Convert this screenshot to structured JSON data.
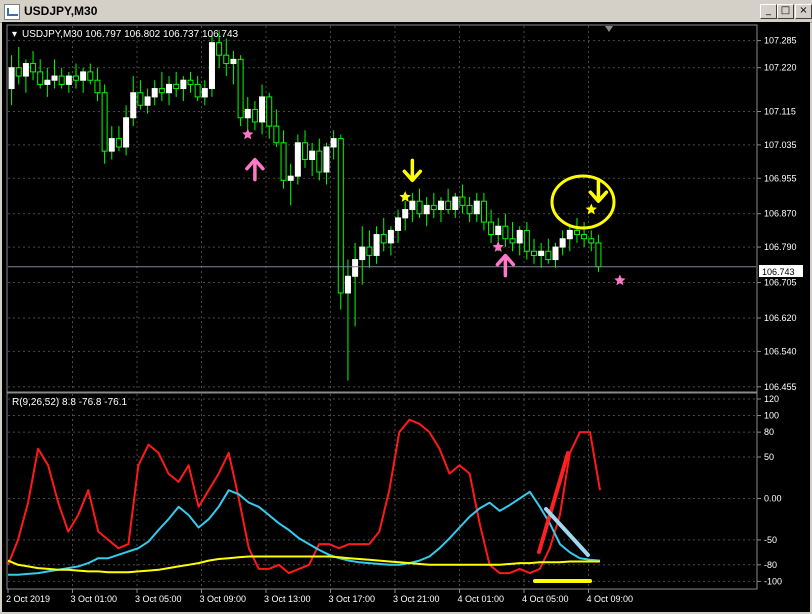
{
  "window": {
    "title": "USDJPY,M30",
    "buttons": {
      "minimize": "_",
      "maximize": "□",
      "close": "×"
    }
  },
  "colors": {
    "background": "#000000",
    "bull_candle": "#ffffff",
    "bear_candle": "#ffffff",
    "wick": "#00ff00",
    "grid": "#4a4a4a",
    "osc_red": "#ff1a1a",
    "osc_cyan": "#33ccee",
    "osc_yellow": "#ffff00",
    "arrow_pink": "#ff77c8",
    "arrow_yellow": "#ffff00",
    "annot_red": "#ff2020",
    "annot_lightblue": "#a0d8f0",
    "annot_yellow": "#ffff00",
    "price_line": "#778899"
  },
  "chart_data": [
    {
      "type": "candlestick",
      "legend": "USDJPY,M30  106.797 106.802 106.737 106.743",
      "current_price": "106.743",
      "y_ticks": [
        "107.285",
        "107.220",
        "107.115",
        "107.035",
        "106.955",
        "106.870",
        "106.790",
        "106.705",
        "106.620",
        "106.540",
        "106.455"
      ],
      "y_tick_values": [
        107.285,
        107.22,
        107.115,
        107.035,
        106.955,
        106.87,
        106.79,
        106.705,
        106.62,
        106.54,
        106.455
      ],
      "ylim": [
        106.445,
        107.32
      ],
      "x_labels": [
        "2 Oct 2019",
        "3 Oct 01:00",
        "3 Oct 05:00",
        "3 Oct 09:00",
        "3 Oct 13:00",
        "3 Oct 17:00",
        "3 Oct 21:00",
        "4 Oct 01:00",
        "4 Oct 05:00",
        "4 Oct 09:00"
      ],
      "candles": [
        [
          107.17,
          107.25,
          107.13,
          107.22
        ],
        [
          107.22,
          107.27,
          107.18,
          107.2
        ],
        [
          107.2,
          107.24,
          107.16,
          107.23
        ],
        [
          107.23,
          107.26,
          107.19,
          107.21
        ],
        [
          107.21,
          107.24,
          107.17,
          107.18
        ],
        [
          107.18,
          107.22,
          107.15,
          107.19
        ],
        [
          107.19,
          107.24,
          107.17,
          107.2
        ],
        [
          107.2,
          107.22,
          107.17,
          107.18
        ],
        [
          107.18,
          107.21,
          107.16,
          107.2
        ],
        [
          107.2,
          107.23,
          107.17,
          107.19
        ],
        [
          107.19,
          107.22,
          107.16,
          107.21
        ],
        [
          107.21,
          107.23,
          107.18,
          107.19
        ],
        [
          107.19,
          107.22,
          107.14,
          107.16
        ],
        [
          107.16,
          107.18,
          106.99,
          107.02
        ],
        [
          107.02,
          107.08,
          107.0,
          107.05
        ],
        [
          107.05,
          107.08,
          107.02,
          107.03
        ],
        [
          107.03,
          107.13,
          107.01,
          107.1
        ],
        [
          107.1,
          107.2,
          107.08,
          107.16
        ],
        [
          107.16,
          107.19,
          107.12,
          107.13
        ],
        [
          107.13,
          107.17,
          107.11,
          107.15
        ],
        [
          107.15,
          107.19,
          107.13,
          107.17
        ],
        [
          107.17,
          107.21,
          107.14,
          107.16
        ],
        [
          107.16,
          107.2,
          107.13,
          107.18
        ],
        [
          107.18,
          107.21,
          107.15,
          107.17
        ],
        [
          107.17,
          107.2,
          107.14,
          107.19
        ],
        [
          107.19,
          107.21,
          107.16,
          107.18
        ],
        [
          107.18,
          107.2,
          107.14,
          107.15
        ],
        [
          107.15,
          107.19,
          107.13,
          107.17
        ],
        [
          107.17,
          107.3,
          107.15,
          107.28
        ],
        [
          107.28,
          107.31,
          107.22,
          107.25
        ],
        [
          107.25,
          107.29,
          107.2,
          107.23
        ],
        [
          107.23,
          107.26,
          107.18,
          107.24
        ],
        [
          107.24,
          107.25,
          107.08,
          107.1
        ],
        [
          107.1,
          107.15,
          107.06,
          107.12
        ],
        [
          107.12,
          107.14,
          107.07,
          107.09
        ],
        [
          107.09,
          107.18,
          107.06,
          107.15
        ],
        [
          107.15,
          107.16,
          107.05,
          107.08
        ],
        [
          107.08,
          107.12,
          107.03,
          107.04
        ],
        [
          107.04,
          107.07,
          106.93,
          106.95
        ],
        [
          106.95,
          106.99,
          106.89,
          106.96
        ],
        [
          106.96,
          107.06,
          106.94,
          107.04
        ],
        [
          107.04,
          107.07,
          106.98,
          107.0
        ],
        [
          107.0,
          107.04,
          106.96,
          107.02
        ],
        [
          107.02,
          107.05,
          106.95,
          106.97
        ],
        [
          106.97,
          107.04,
          106.94,
          107.03
        ],
        [
          107.03,
          107.07,
          107.0,
          107.05
        ],
        [
          107.05,
          107.06,
          106.64,
          106.68
        ],
        [
          106.68,
          106.76,
          106.47,
          106.72
        ],
        [
          106.72,
          106.8,
          106.6,
          106.76
        ],
        [
          106.76,
          106.84,
          106.7,
          106.79
        ],
        [
          106.79,
          106.83,
          106.74,
          106.77
        ],
        [
          106.77,
          106.84,
          106.75,
          106.82
        ],
        [
          106.82,
          106.86,
          106.78,
          106.8
        ],
        [
          106.8,
          106.84,
          106.77,
          106.83
        ],
        [
          106.83,
          106.88,
          106.8,
          106.86
        ],
        [
          106.86,
          106.9,
          106.83,
          106.88
        ],
        [
          106.88,
          106.92,
          106.85,
          106.9
        ],
        [
          106.9,
          106.93,
          106.86,
          106.87
        ],
        [
          106.87,
          106.91,
          106.84,
          106.89
        ],
        [
          106.89,
          106.92,
          106.86,
          106.88
        ],
        [
          106.88,
          106.91,
          106.85,
          106.9
        ],
        [
          106.9,
          106.93,
          106.87,
          106.88
        ],
        [
          106.88,
          106.92,
          106.86,
          106.91
        ],
        [
          106.91,
          106.94,
          106.87,
          106.89
        ],
        [
          106.89,
          106.91,
          106.85,
          106.87
        ],
        [
          106.87,
          106.92,
          106.85,
          106.9
        ],
        [
          106.9,
          106.92,
          106.83,
          106.85
        ],
        [
          106.85,
          106.88,
          106.8,
          106.82
        ],
        [
          106.82,
          106.86,
          106.78,
          106.84
        ],
        [
          106.84,
          106.87,
          106.79,
          106.81
        ],
        [
          106.81,
          106.85,
          106.78,
          106.8
        ],
        [
          106.8,
          106.84,
          106.77,
          106.83
        ],
        [
          106.83,
          106.85,
          106.76,
          106.78
        ],
        [
          106.78,
          106.81,
          106.75,
          106.77
        ],
        [
          106.77,
          106.8,
          106.74,
          106.78
        ],
        [
          106.78,
          106.81,
          106.75,
          106.76
        ],
        [
          106.76,
          106.8,
          106.74,
          106.79
        ],
        [
          106.79,
          106.83,
          106.77,
          106.81
        ],
        [
          106.81,
          106.84,
          106.78,
          106.83
        ],
        [
          106.83,
          106.86,
          106.8,
          106.82
        ],
        [
          106.82,
          106.85,
          106.79,
          106.81
        ],
        [
          106.81,
          106.83,
          106.78,
          106.8
        ],
        [
          106.8,
          106.82,
          106.73,
          106.743
        ]
      ],
      "signals": [
        {
          "kind": "pink-star",
          "index": 33,
          "price": 107.06
        },
        {
          "kind": "pink-up-arrow",
          "index": 34,
          "price": 106.99
        },
        {
          "kind": "yellow-down-arrow",
          "index": 56,
          "price": 106.95
        },
        {
          "kind": "yellow-star",
          "index": 55,
          "price": 106.91
        },
        {
          "kind": "pink-star",
          "index": 68,
          "price": 106.79
        },
        {
          "kind": "pink-up-arrow",
          "index": 69,
          "price": 106.76
        },
        {
          "kind": "yellow-down-arrow",
          "index": 82,
          "price": 106.9
        },
        {
          "kind": "yellow-star",
          "index": 81,
          "price": 106.88
        },
        {
          "kind": "pink-star",
          "index": 85,
          "price": 106.71
        }
      ]
    },
    {
      "type": "line",
      "legend": "R(9,26,52) 8.8 -76.8 -76.1",
      "y_ticks": [
        "120",
        "100",
        "80",
        "50",
        "0.00",
        "-50",
        "-80",
        "-100"
      ],
      "y_tick_values": [
        120,
        100,
        80,
        50,
        0,
        -50,
        -80,
        -100
      ],
      "ylim": [
        -108,
        126
      ],
      "series": [
        {
          "color": "#ff1a1a",
          "values": [
            -80,
            -50,
            -5,
            60,
            40,
            -5,
            -40,
            -20,
            10,
            -40,
            -50,
            -60,
            -55,
            40,
            65,
            55,
            30,
            20,
            40,
            -10,
            10,
            30,
            55,
            0,
            -60,
            -85,
            -85,
            -80,
            -90,
            -85,
            -80,
            -55,
            -55,
            -60,
            -55,
            -55,
            -55,
            -40,
            10,
            80,
            95,
            90,
            80,
            60,
            30,
            40,
            30,
            -30,
            -80,
            -90,
            -90,
            -85,
            -90,
            -85,
            -60,
            -20,
            55,
            80,
            80,
            10
          ]
        },
        {
          "color": "#33ccee",
          "values": [
            -92,
            -92,
            -91,
            -90,
            -88,
            -86,
            -84,
            -82,
            -78,
            -72,
            -72,
            -68,
            -64,
            -60,
            -52,
            -38,
            -25,
            -10,
            -20,
            -35,
            -25,
            -10,
            10,
            5,
            -5,
            -10,
            -20,
            -30,
            -38,
            -48,
            -55,
            -62,
            -68,
            -72,
            -75,
            -77,
            -78,
            -79,
            -80,
            -80,
            -78,
            -75,
            -70,
            -60,
            -48,
            -35,
            -22,
            -12,
            -5,
            -15,
            -8,
            0,
            8,
            -10,
            -30,
            -55,
            -65,
            -72,
            -74,
            -75
          ]
        },
        {
          "color": "#ffff00",
          "values": [
            -75,
            -80,
            -82,
            -84,
            -85,
            -86,
            -86,
            -87,
            -88,
            -88,
            -89,
            -89,
            -89,
            -88,
            -87,
            -86,
            -84,
            -82,
            -80,
            -78,
            -75,
            -73,
            -72,
            -71,
            -70,
            -70,
            -70,
            -70,
            -70,
            -70,
            -70,
            -70,
            -70,
            -71,
            -72,
            -73,
            -74,
            -75,
            -76,
            -77,
            -78,
            -79,
            -80,
            -80,
            -80,
            -80,
            -80,
            -80,
            -80,
            -80,
            -79,
            -78,
            -78,
            -77,
            -77,
            -77,
            -76,
            -76,
            -76,
            -76
          ]
        }
      ]
    }
  ]
}
